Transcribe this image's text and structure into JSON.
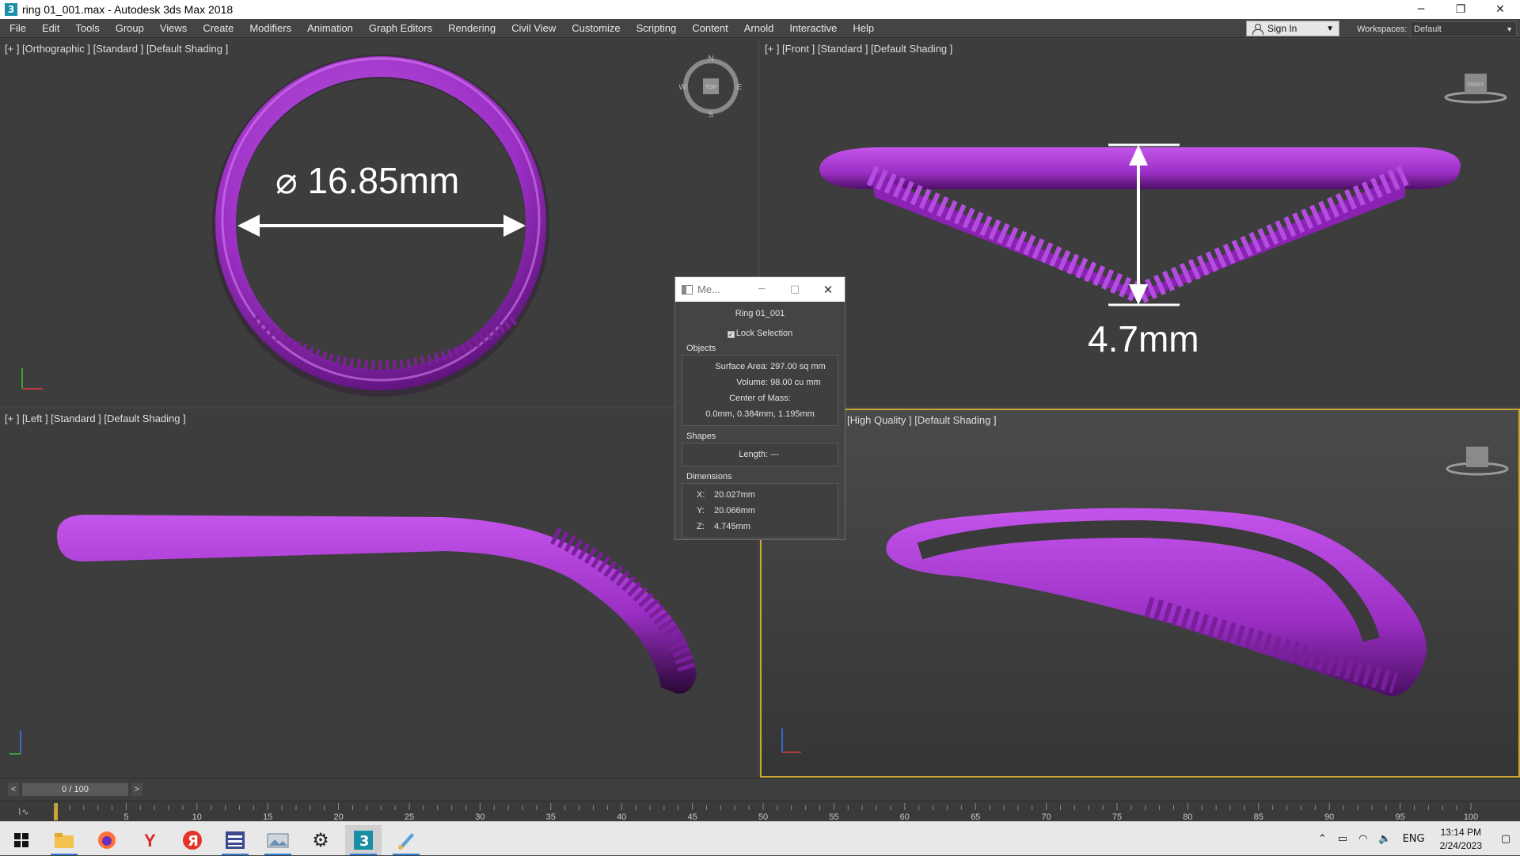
{
  "window": {
    "title": "ring 01_001.max - Autodesk 3ds Max 2018",
    "app_icon": "3",
    "minimize": "─",
    "restore": "❐",
    "close": "✕"
  },
  "menu": [
    "File",
    "Edit",
    "Tools",
    "Group",
    "Views",
    "Create",
    "Modifiers",
    "Animation",
    "Graph Editors",
    "Rendering",
    "Civil View",
    "Customize",
    "Scripting",
    "Content",
    "Arnold",
    "Interactive",
    "Help"
  ],
  "signin": {
    "label": "Sign In"
  },
  "workspaces": {
    "label": "Workspaces:",
    "value": "Default"
  },
  "viewports": {
    "top_left": {
      "label": "[+ ] [Orthographic ] [Standard ] [Default Shading ]",
      "annotation": "⌀ 16.85mm"
    },
    "top_right": {
      "label": "[+ ] [Front ] [Standard ] [Default Shading ]",
      "annotation": "4.7mm"
    },
    "bottom_left": {
      "label": "[+ ] [Left ] [Standard ] [Default Shading ]"
    },
    "bottom_right": {
      "label": "[High Quality ] [Default Shading ]"
    }
  },
  "compass": {
    "n": "N",
    "s": "S",
    "e": "E",
    "w": "W",
    "top": "TOP"
  },
  "viewcube": {
    "front": "FRONT"
  },
  "measure": {
    "title": "Me...",
    "object_name": "Ring 01_001",
    "lock_selection": "Lock Selection",
    "objects_title": "Objects",
    "surface_area_label": "Surface Area:",
    "surface_area_value": "297.00 sq mm",
    "volume_label": "Volume:",
    "volume_value": "98.00 cu mm",
    "center_of_mass_label": "Center of Mass:",
    "center_of_mass_value": "0.0mm, 0.384mm, 1.195mm",
    "shapes_title": "Shapes",
    "length_label": "Length:",
    "length_value": "---",
    "dimensions_title": "Dimensions",
    "x_label": "X:",
    "x_value": "20.027mm",
    "y_label": "Y:",
    "y_value": "20.066mm",
    "z_label": "Z:",
    "z_value": "4.745mm"
  },
  "timeslider": {
    "value": "0 / 100",
    "prev": "<",
    "next": ">"
  },
  "track_ticks": [
    "5",
    "10",
    "15",
    "20",
    "25",
    "30",
    "35",
    "40",
    "45",
    "50",
    "55",
    "60",
    "65",
    "70",
    "75",
    "80",
    "85",
    "90",
    "95",
    "100"
  ],
  "taskbar": {
    "tray": {
      "lang": "ENG",
      "time": "13:14 PM",
      "date": "2/24/2023"
    }
  },
  "colors": {
    "ring": "#9b2fc4",
    "viewport_bg": "#3d3d3d",
    "active_border": "#c9a634"
  }
}
